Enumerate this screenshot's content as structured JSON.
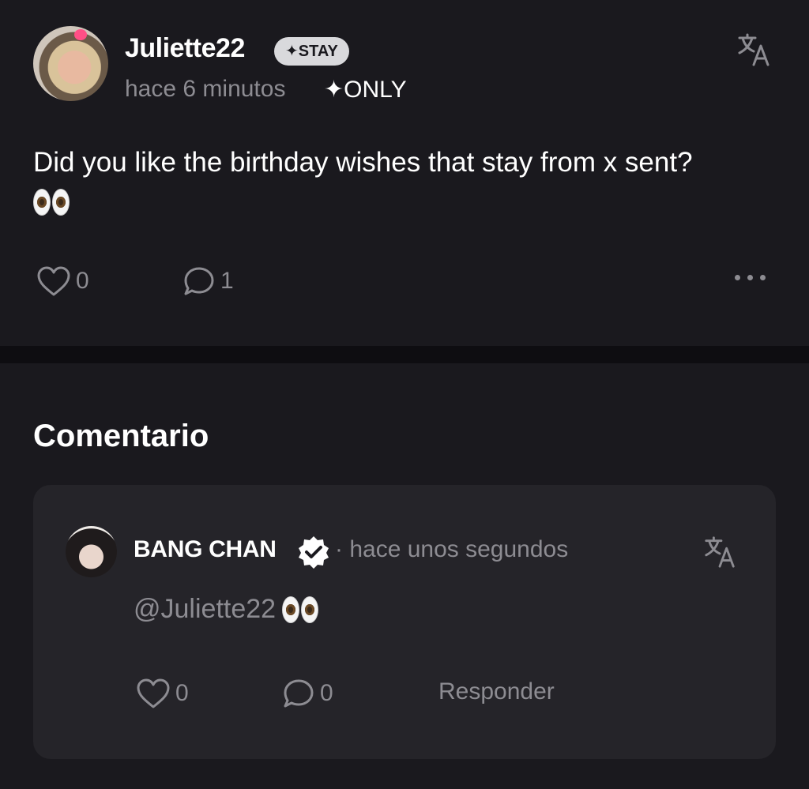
{
  "post": {
    "username": "Juliette22",
    "badge": "✦STAY",
    "time": "hace 6 minutos",
    "visibility": "✦ONLY",
    "text": "Did you like the birthday wishes that stay from x sent?",
    "likes": "0",
    "comments": "1"
  },
  "comments_section": {
    "title": "Comentario",
    "items": [
      {
        "username": "BANG CHAN",
        "time": "· hace unos segundos",
        "text": "@Juliette22",
        "likes": "0",
        "replies": "0",
        "reply_label": "Responder"
      }
    ]
  },
  "colors": {
    "background": "#1a191e",
    "card": "#252429",
    "muted_text": "#8d8c92",
    "badge_bg": "#d9d9dc"
  },
  "icons": [
    "translate-icon",
    "heart-icon",
    "comment-icon",
    "more-icon",
    "verified-icon",
    "eyes-emoji"
  ]
}
